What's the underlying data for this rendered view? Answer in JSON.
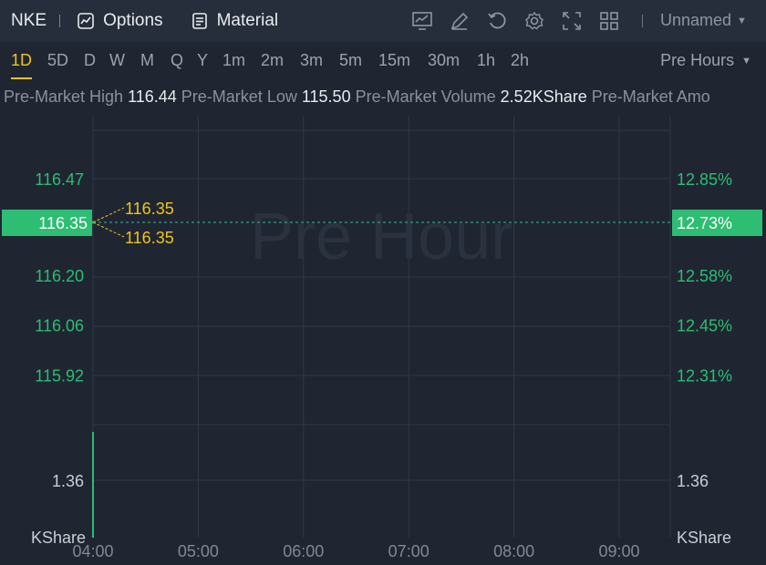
{
  "header": {
    "symbol": "NKE",
    "options_label": "Options",
    "material_label": "Material",
    "layout_name": "Unnamed",
    "tool_icons": [
      "chart-icon",
      "draw-icon",
      "undo-icon",
      "settings-icon",
      "fullscreen-icon",
      "layout-grid-icon"
    ]
  },
  "periods": {
    "items": [
      "1D",
      "5D",
      "D",
      "W",
      "M",
      "Q",
      "Y",
      "1m",
      "2m",
      "3m",
      "5m",
      "15m",
      "30m",
      "1h",
      "2h"
    ],
    "active": "1D",
    "session": "Pre Hours"
  },
  "stats": {
    "high_label": "Pre-Market High",
    "high_value": "116.44",
    "low_label": "Pre-Market Low",
    "low_value": "115.50",
    "volume_label": "Pre-Market Volume",
    "volume_value": "2.52KShare",
    "amount_label": "Pre-Market Amo"
  },
  "colors": {
    "up": "#2dbd73",
    "accent": "#f0c419",
    "background": "#1f2632"
  },
  "chart": {
    "watermark": "Pre Hour",
    "current_price": "116.35",
    "current_pct": "12.73%",
    "last_prices": [
      "116.35",
      "116.35"
    ],
    "left_ticks": [
      "116.47",
      "116.20",
      "116.06",
      "115.92"
    ],
    "right_ticks": [
      "12.85%",
      "12.58%",
      "12.45%",
      "12.31%"
    ],
    "volume_tick_left": "1.36",
    "volume_tick_right": "1.36",
    "volume_unit_left": "KShare",
    "volume_unit_right": "KShare",
    "x_ticks": [
      "04:00",
      "05:00",
      "06:00",
      "07:00",
      "08:00",
      "09:00"
    ]
  },
  "chart_data": {
    "type": "line",
    "x": [
      "04:00"
    ],
    "series": [
      {
        "values": [
          116.35
        ]
      }
    ],
    "volume": {
      "x": [
        "04:00"
      ],
      "values": [
        1.36
      ],
      "unit": "KShare"
    },
    "y_ticks": [
      116.47,
      116.35,
      116.2,
      116.06,
      115.92
    ],
    "y_pct_ticks": [
      "12.85%",
      "12.73%",
      "12.58%",
      "12.45%",
      "12.31%"
    ],
    "x_ticks": [
      "04:00",
      "05:00",
      "06:00",
      "07:00",
      "08:00",
      "09:00"
    ],
    "grid": true
  }
}
